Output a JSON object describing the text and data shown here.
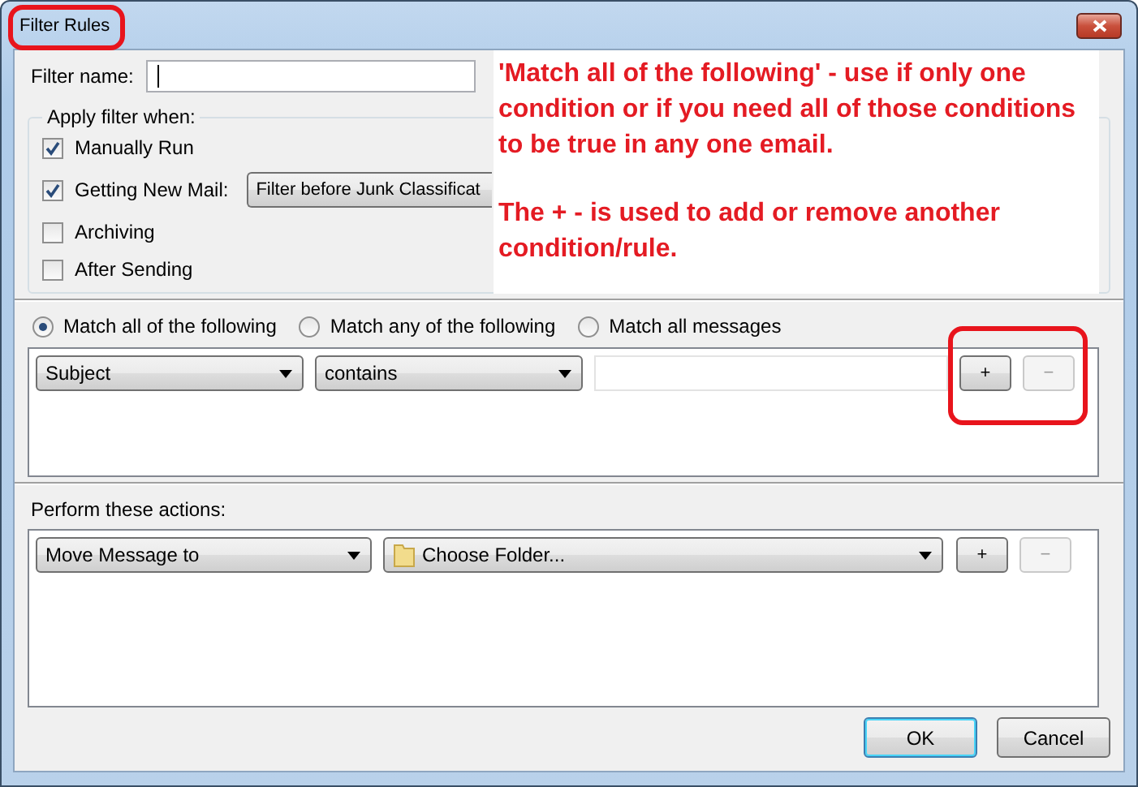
{
  "window": {
    "title": "Filter Rules"
  },
  "filter_name": {
    "label": "Filter name:",
    "focused": true
  },
  "apply_filter": {
    "label": "Apply filter when:",
    "options": [
      {
        "label": "Manually Run",
        "checked": true
      },
      {
        "label": "Getting New Mail:",
        "checked": true,
        "dropdown": "Filter before Junk Classificat"
      },
      {
        "label": "Archiving",
        "checked": false
      },
      {
        "label": "After Sending",
        "checked": false
      }
    ]
  },
  "match_modes": [
    {
      "label": "Match all of the following",
      "selected": true
    },
    {
      "label": "Match any of the following",
      "selected": false
    },
    {
      "label": "Match all messages",
      "selected": false
    }
  ],
  "conditions": [
    {
      "field": "Subject",
      "operator": "contains",
      "add": "+",
      "remove": "−",
      "remove_disabled": true
    }
  ],
  "actions_section": {
    "label": "Perform these actions:",
    "actions": [
      {
        "action": "Move Message to",
        "target": "Choose Folder...",
        "add": "+",
        "remove": "−",
        "remove_disabled": true
      }
    ]
  },
  "buttons": [
    {
      "label": "OK",
      "default": true
    },
    {
      "label": "Cancel",
      "default": false
    }
  ],
  "annotation": {
    "paragraphs": [
      "'Match all of the following' - use if only one condition or if you need all of those conditions to be true in any one email.",
      "The + - is used to add or remove another condition/rule."
    ]
  }
}
